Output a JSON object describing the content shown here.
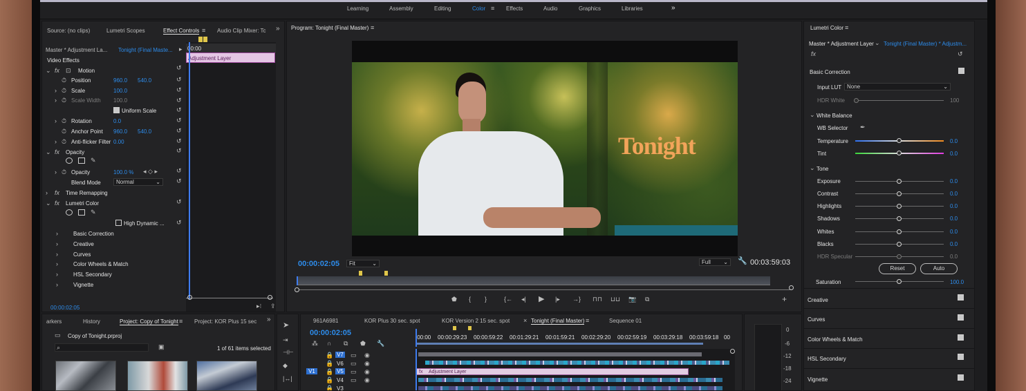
{
  "workspaces": {
    "tabs": [
      "Learning",
      "Assembly",
      "Editing",
      "Color",
      "Effects",
      "Audio",
      "Graphics",
      "Libraries"
    ],
    "active": "Color",
    "more": "»"
  },
  "source_panel": {
    "tabs": [
      "Source: (no clips)",
      "Lumetri Scopes",
      "Effect Controls",
      "Audio Clip Mixer: Tc"
    ],
    "active_tab": "Effect Controls",
    "clip_master": "Master * Adjustment La...",
    "clip_seq": "Tonight (Final Maste...",
    "mini_timecode": "00:00",
    "mini_clip": "Adjustment Layer",
    "section": "Video Effects",
    "motion": "Motion",
    "position_label": "Position",
    "position_x": "960.0",
    "position_y": "540.0",
    "scale_label": "Scale",
    "scale_val": "100.0",
    "scale_width_label": "Scale Width",
    "scale_width_val": "100.0",
    "uniform_scale": "Uniform Scale",
    "rotation_label": "Rotation",
    "rotation_val": "0.0",
    "anchor_label": "Anchor Point",
    "anchor_x": "960.0",
    "anchor_y": "540.0",
    "antiflicker_label": "Anti-flicker Filter",
    "antiflicker_val": "0.00",
    "opacity_section": "Opacity",
    "opacity_label": "Opacity",
    "opacity_val": "100.0 %",
    "blend_label": "Blend Mode",
    "blend_val": "Normal",
    "time_remap": "Time Remapping",
    "lumetri": "Lumetri Color",
    "high_dynamic": "High Dynamic ...",
    "sub_items": [
      "Basic Correction",
      "Creative",
      "Curves",
      "Color Wheels & Match",
      "HSL Secondary",
      "Vignette"
    ],
    "timecode": "00:00:02:05"
  },
  "program": {
    "title": "Program: Tonight (Final Master)",
    "overlay_text": "Tonight",
    "timecode": "00:00:02:05",
    "fit": "Fit",
    "quality": "Full",
    "duration": "00:03:59:03"
  },
  "lumetri_panel": {
    "title": "Lumetri Color",
    "master": "Master * Adjustment Layer",
    "seq": "Tonight (Final Master) * Adjustm...",
    "basic": "Basic Correction",
    "input_lut_label": "Input LUT",
    "input_lut_val": "None",
    "hdr_white_label": "HDR White",
    "hdr_white_val": "100",
    "white_balance": "White Balance",
    "wb_selector": "WB Selector",
    "temperature_label": "Temperature",
    "temperature_val": "0.0",
    "tint_label": "Tint",
    "tint_val": "0.0",
    "tone": "Tone",
    "exposure_label": "Exposure",
    "exposure_val": "0.0",
    "contrast_label": "Contrast",
    "contrast_val": "0.0",
    "highlights_label": "Highlights",
    "highlights_val": "0.0",
    "shadows_label": "Shadows",
    "shadows_val": "0.0",
    "whites_label": "Whites",
    "whites_val": "0.0",
    "blacks_label": "Blacks",
    "blacks_val": "0.0",
    "hdr_specular_label": "HDR Specular",
    "hdr_specular_val": "0.0",
    "reset": "Reset",
    "auto": "Auto",
    "saturation_label": "Saturation",
    "saturation_val": "100.0",
    "sections": [
      "Creative",
      "Curves",
      "Color Wheels & Match",
      "HSL Secondary",
      "Vignette"
    ]
  },
  "project_panel": {
    "tabs": [
      "arkers",
      "History",
      "Project: Copy of Tonight",
      "Project: KOR Plus 15 sec"
    ],
    "active_tab": "Project: Copy of Tonight",
    "file": "Copy of Tonight.prproj",
    "items_count": "1 of 61 items selected"
  },
  "timeline": {
    "tabs": [
      "961A6981",
      "KOR Plus 30 sec. spot",
      "KOR Version 2 15 sec. spot",
      "Tonight (Final Master)",
      "Sequence 01"
    ],
    "active_tab": "Tonight (Final Master)",
    "timecode": "00:00:02:05",
    "ruler": [
      ":00:00",
      "00:00:29:23",
      "00:00:59:22",
      "00:01:29:21",
      "00:01:59:21",
      "00:02:29:20",
      "00:02:59:19",
      "00:03:29:18",
      "00:03:59:18",
      "00"
    ],
    "tracks": [
      "V7",
      "V6",
      "V5",
      "V4",
      "V3"
    ],
    "v1": "V1",
    "adj_clip": "Adjustment Layer",
    "meter": [
      "0",
      "-6",
      "-12",
      "-18",
      "-24"
    ]
  }
}
